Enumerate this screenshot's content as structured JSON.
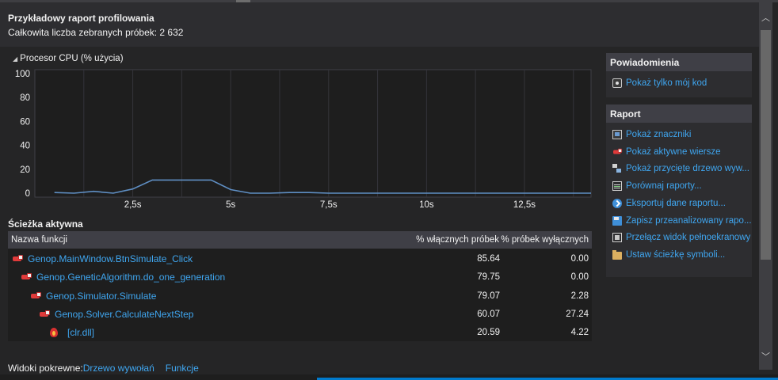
{
  "header": {
    "title": "Przykładowy raport profilowania",
    "subtitle": "Całkowita liczba zebranych próbek: 2 632"
  },
  "cpu": {
    "section_label": "Procesor CPU (% użycia)"
  },
  "chart_data": {
    "type": "line",
    "title": "Procesor CPU (% użycia)",
    "ylim": [
      0,
      100
    ],
    "xlim": [
      0,
      14.2
    ],
    "y_ticks": [
      "100",
      "80",
      "60",
      "40",
      "20",
      "0"
    ],
    "x_ticks": [
      "2,5s",
      "5s",
      "7,5s",
      "10s",
      "12,5s"
    ],
    "x_tick_values": [
      2.5,
      5,
      7.5,
      10,
      12.5
    ],
    "grid": true,
    "series": [
      {
        "color": "#5f8fc4",
        "x": [
          0.5,
          1.0,
          1.5,
          2.0,
          2.5,
          3.0,
          3.5,
          4.0,
          4.5,
          5.0,
          5.5,
          6.0,
          6.5,
          7.0,
          7.5,
          8.0,
          9.0,
          10.0,
          11.0,
          12.0,
          13.0,
          14.2
        ],
        "y": [
          0.5,
          0,
          1.5,
          0,
          3.5,
          11,
          11,
          11,
          11,
          3,
          0,
          0,
          0.5,
          0.5,
          0,
          0,
          0,
          0,
          0,
          0,
          0,
          0
        ]
      }
    ]
  },
  "hot_path": {
    "section_label": "Ścieżka aktywna",
    "columns": [
      "Nazwa funkcji",
      "% włącznych próbek",
      "% próbek wyłącznych"
    ],
    "rows": [
      {
        "name": "Genop.MainWindow.BtnSimulate_Click",
        "inclusive": "85.64",
        "exclusive": "0.00",
        "icon": "hot-path-icon"
      },
      {
        "name": "Genop.GeneticAlgorithm.do_one_generation",
        "inclusive": "79.75",
        "exclusive": "0.00",
        "icon": "hot-path-icon"
      },
      {
        "name": "Genop.Simulator.Simulate",
        "inclusive": "79.07",
        "exclusive": "2.28",
        "icon": "hot-path-icon"
      },
      {
        "name": "Genop.Solver.CalculateNextStep",
        "inclusive": "60.07",
        "exclusive": "27.24",
        "icon": "hot-path-icon"
      },
      {
        "name": "[clr.dll]",
        "inclusive": "20.59",
        "exclusive": "4.22",
        "icon": "hot-item-icon"
      }
    ]
  },
  "views": {
    "label": "Widoki pokrewne:",
    "links": [
      "Drzewo wywołań",
      "Funkcje"
    ]
  },
  "notifications": {
    "title": "Powiadomienia",
    "items": [
      {
        "label": "Pokaż tylko mój kod",
        "icon": "just-my-code-icon"
      }
    ]
  },
  "report": {
    "title": "Raport",
    "items": [
      {
        "label": "Pokaż znaczniki",
        "icon": "marks-icon"
      },
      {
        "label": "Pokaż aktywne wiersze",
        "icon": "hot-lines-icon"
      },
      {
        "label": "Pokaż przycięte drzewo wyw...",
        "icon": "trimmed-tree-icon"
      },
      {
        "label": "Porównaj raporty...",
        "icon": "compare-icon"
      },
      {
        "label": "Eksportuj dane raportu...",
        "icon": "export-icon"
      },
      {
        "label": "Zapisz przeanalizowany rapo...",
        "icon": "save-icon"
      },
      {
        "label": "Przełącz widok pełnoekranowy",
        "icon": "fullscreen-icon"
      },
      {
        "label": "Ustaw ścieżkę symboli...",
        "icon": "folder-icon"
      }
    ]
  },
  "colors": {
    "background": "#252526",
    "link": "#3fa6f0",
    "chart_line": "#5f8fc4",
    "accent": "#007acc"
  }
}
